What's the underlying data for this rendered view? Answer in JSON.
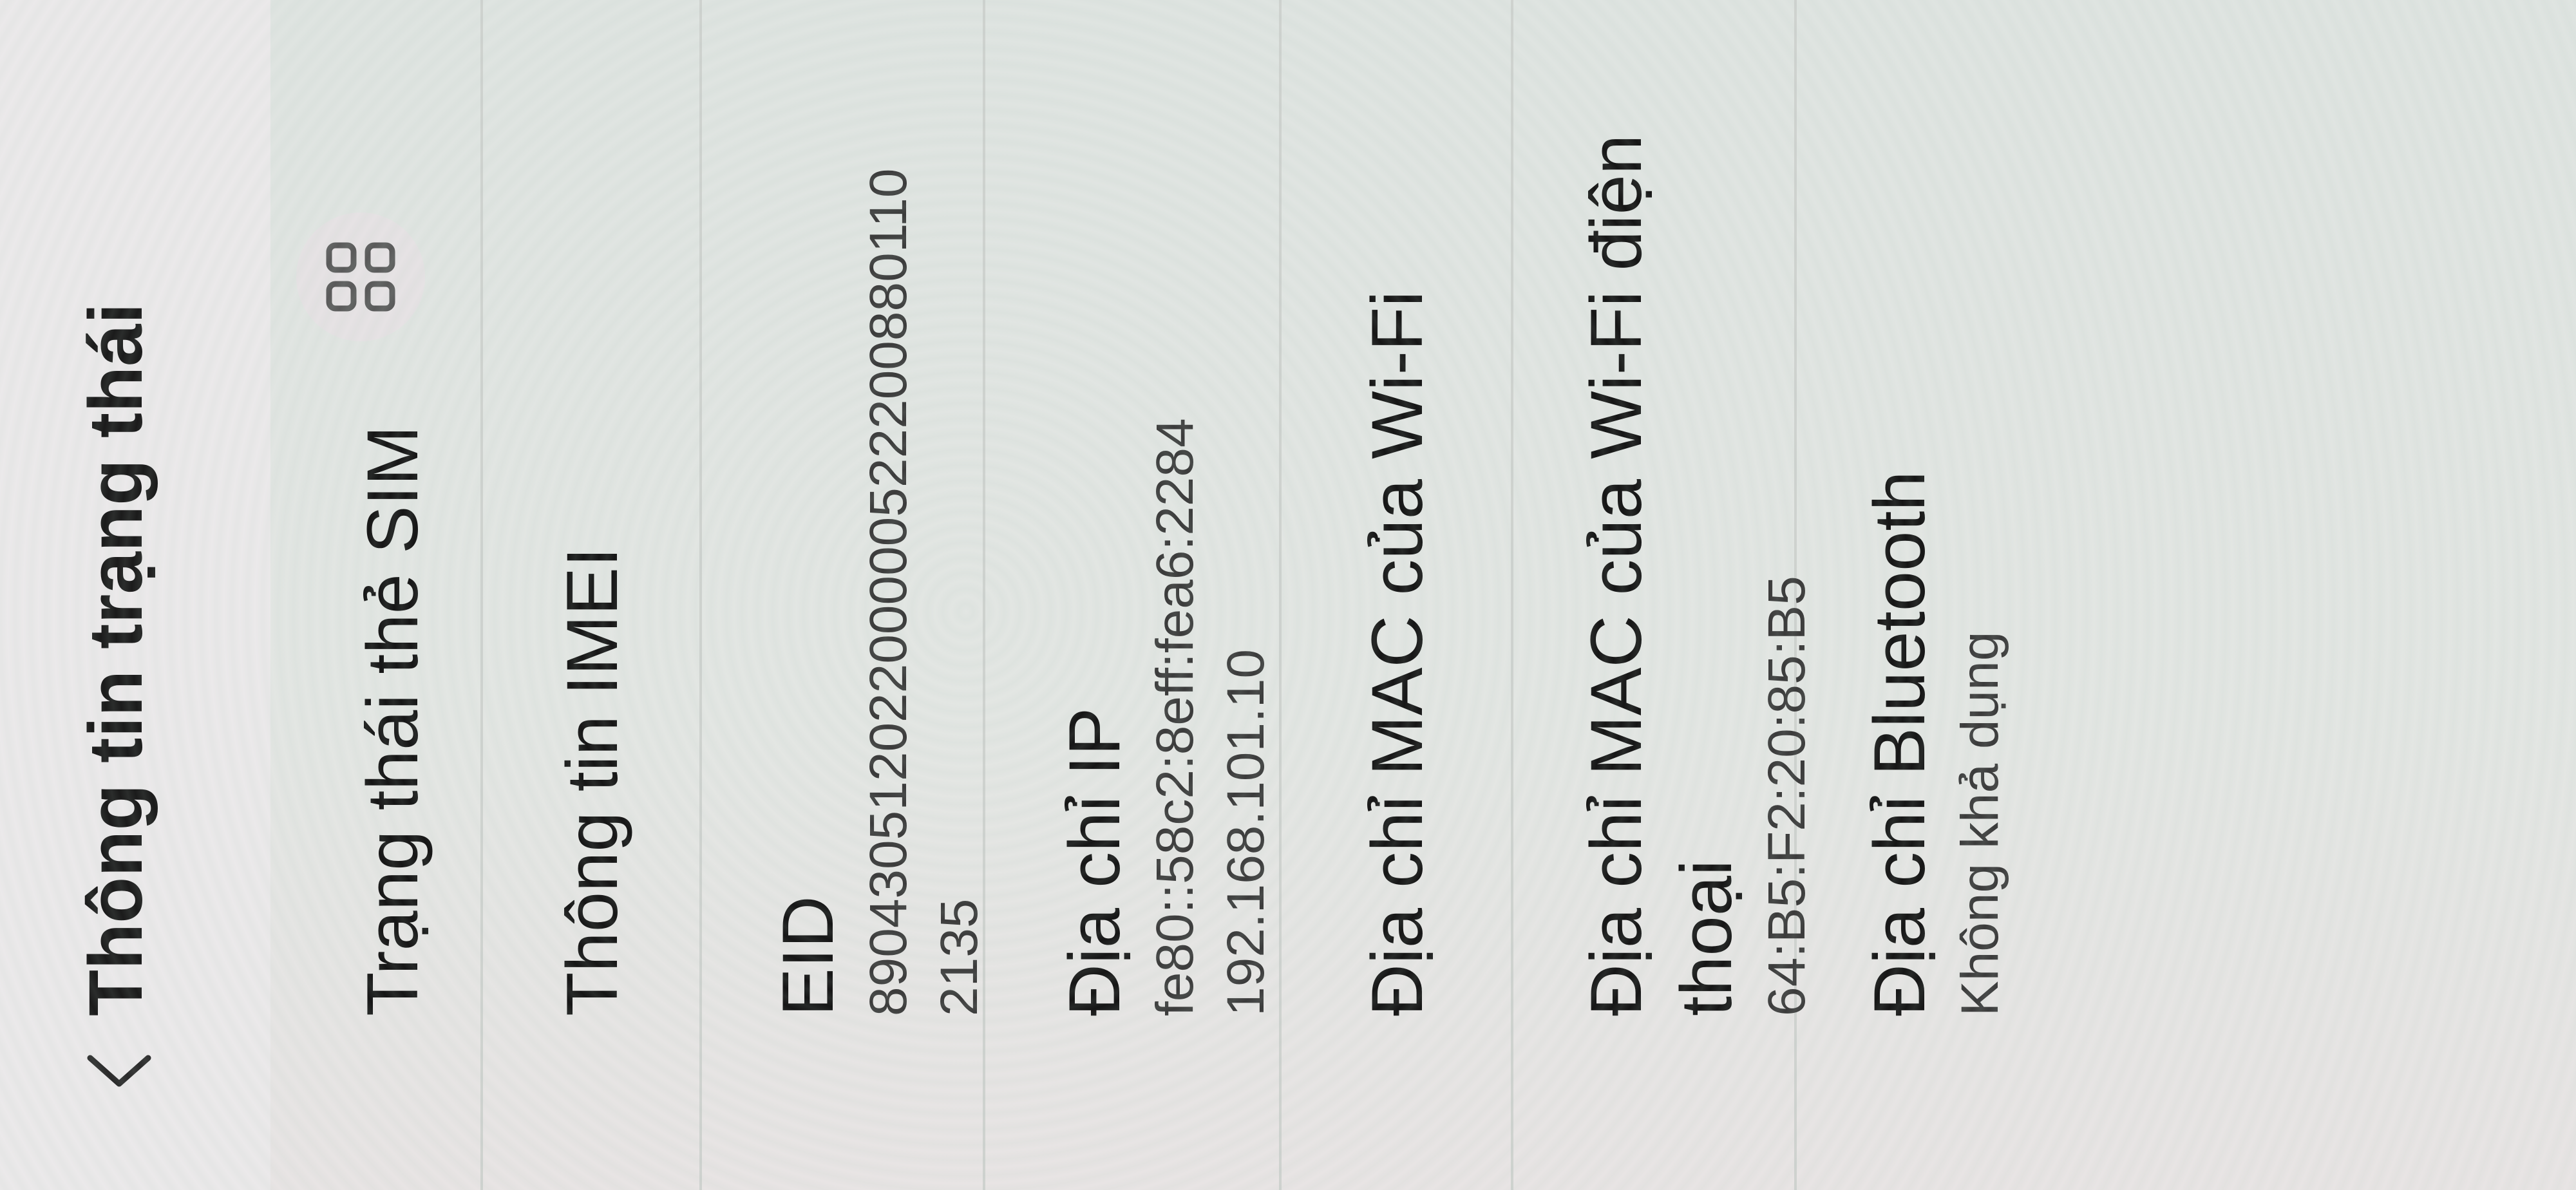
{
  "header": {
    "back_icon": "chevron-left-icon",
    "title": "Thông tin trạng thái"
  },
  "items": [
    {
      "title": "Trạng thái thẻ SIM",
      "action_icon": "qr-code-icon"
    },
    {
      "title": "Thông tin IMEI"
    },
    {
      "title": "EID",
      "value_lines": [
        "89043051202200000522200880110",
        "2135"
      ]
    },
    {
      "title": "Địa chỉ IP",
      "value_lines": [
        "fe80::58c2:8eff:fea6:2284",
        "192.168.101.10"
      ]
    },
    {
      "title": "Địa chỉ MAC của Wi-Fi"
    },
    {
      "title_lines": [
        "Địa chỉ MAC của Wi-Fi điện",
        "thoại"
      ],
      "value": "64:B5:F2:20:85:B5"
    },
    {
      "title": "Địa chỉ Bluetooth",
      "value": "Không khả dụng"
    }
  ]
}
